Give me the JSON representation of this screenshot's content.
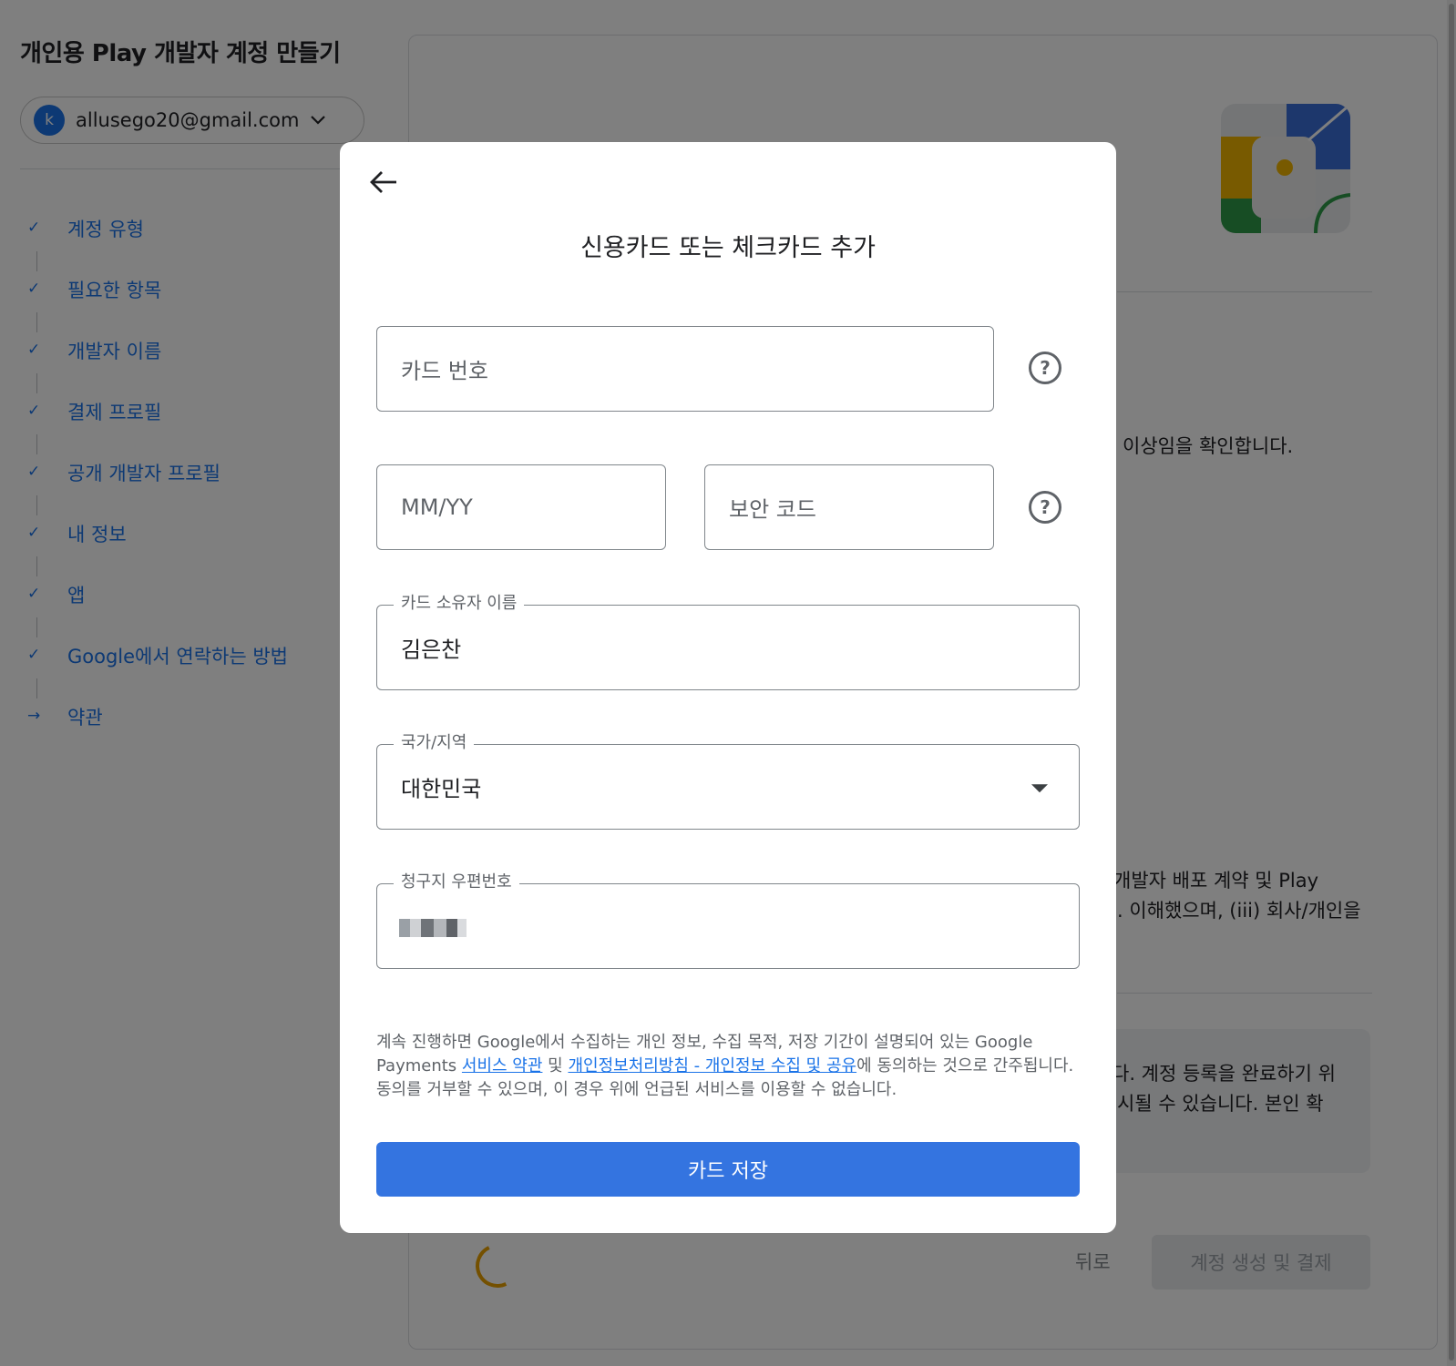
{
  "page": {
    "title": "개인용 Play 개발자 계정 만들기",
    "account": {
      "avatar_letter": "k",
      "email": "allusego20@gmail.com"
    },
    "steps": [
      {
        "label": "계정 유형",
        "state": "done"
      },
      {
        "label": "필요한 항목",
        "state": "done"
      },
      {
        "label": "개발자 이름",
        "state": "done"
      },
      {
        "label": "결제 프로필",
        "state": "done"
      },
      {
        "label": "공개 개발자 프로필",
        "state": "done"
      },
      {
        "label": "내 정보",
        "state": "done"
      },
      {
        "label": "앱",
        "state": "done"
      },
      {
        "label": "Google에서 연락하는 방법",
        "state": "done"
      },
      {
        "label": "약관",
        "state": "current"
      }
    ],
    "background_text": {
      "line1": "이상임을 확인합니다.",
      "line2": "개발자 배포 계약 및 Play",
      "line3": ". 이해했으며, (iii) 회사/개인을",
      "notice1": "다. 계정 등록을 완료하기 위",
      "notice2": "시될 수 있습니다. 본인 확"
    },
    "back_label": "뒤로",
    "create_label": "계정 생성 및 결제"
  },
  "modal": {
    "title": "신용카드 또는 체크카드 추가",
    "card_number_placeholder": "카드 번호",
    "expiry_placeholder": "MM/YY",
    "cvc_placeholder": "보안 코드",
    "holder_label": "카드 소유자 이름",
    "holder_value": "김은찬",
    "country_label": "국가/지역",
    "country_value": "대한민국",
    "zip_label": "청구지 우편번호",
    "help_glyph": "?",
    "consent": {
      "part1": "계속 진행하면 Google에서 수집하는 개인 정보, 수집 목적, 저장 기간이 설명되어 있는 Google Payments ",
      "link1": "서비스 약관",
      "part2": " 및 ",
      "link2": "개인정보처리방침 - 개인정보 수집 및 공유",
      "part3": "에 동의하는 것으로 간주됩니다. 동의를 거부할 수 있으며, 이 경우 위에 언급된 서비스를 이용할 수 없습니다."
    },
    "save_label": "카드 저장"
  },
  "colors": {
    "accent": "#1a73e8",
    "button": "#3474e0",
    "scrim": "rgba(0,0,0,0.5)"
  },
  "icons": [
    "back-arrow-icon",
    "help-icon",
    "chevron-down-icon",
    "check-icon",
    "arrow-right-icon",
    "dropdown-caret-icon"
  ]
}
